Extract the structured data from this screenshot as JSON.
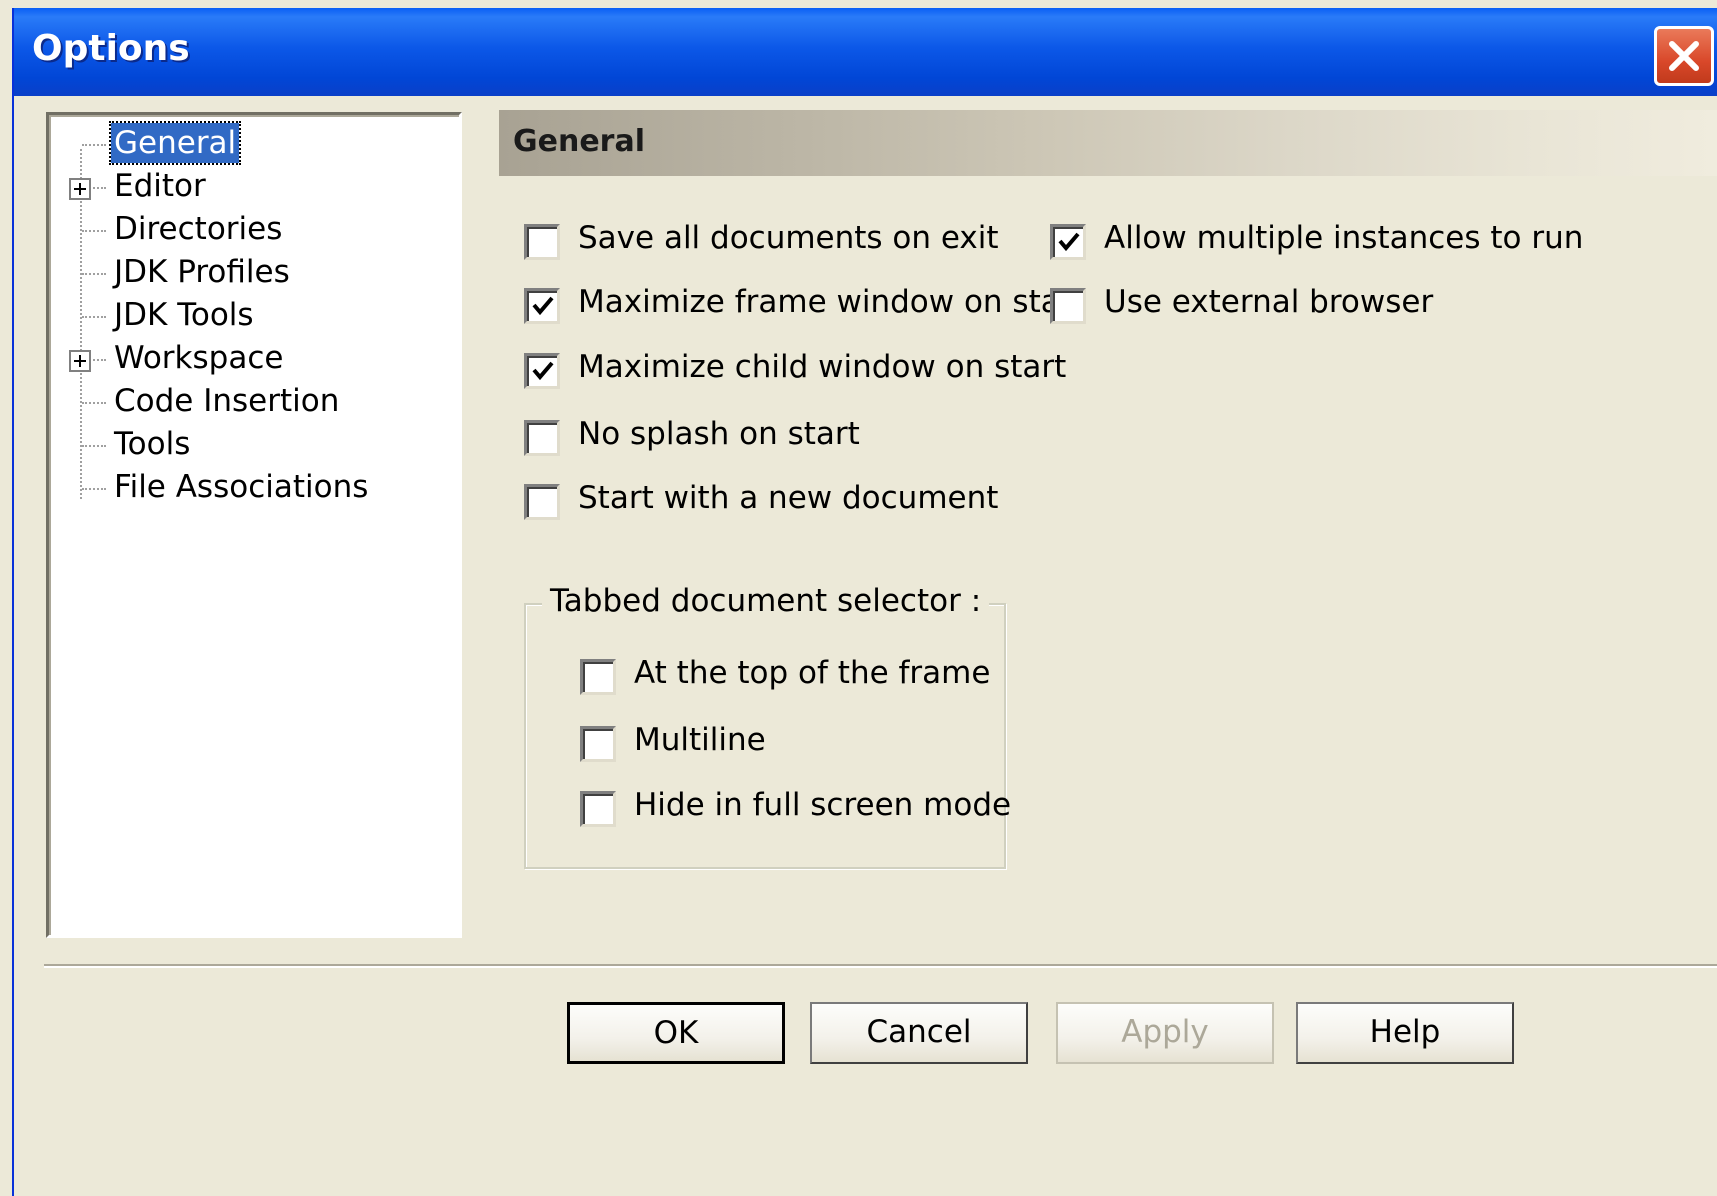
{
  "window": {
    "title": "Options"
  },
  "tree": {
    "items": [
      {
        "label": "General",
        "expandable": false,
        "selected": true
      },
      {
        "label": "Editor",
        "expandable": true,
        "selected": false
      },
      {
        "label": "Directories",
        "expandable": false,
        "selected": false
      },
      {
        "label": "JDK Profiles",
        "expandable": false,
        "selected": false
      },
      {
        "label": "JDK Tools",
        "expandable": false,
        "selected": false
      },
      {
        "label": "Workspace",
        "expandable": true,
        "selected": false
      },
      {
        "label": "Code Insertion",
        "expandable": false,
        "selected": false
      },
      {
        "label": "Tools",
        "expandable": false,
        "selected": false
      },
      {
        "label": "File Associations",
        "expandable": false,
        "selected": false
      }
    ]
  },
  "panel": {
    "title": "General"
  },
  "options": {
    "save_all": {
      "label": "Save all documents on exit",
      "checked": false
    },
    "max_frame": {
      "label": "Maximize frame window on start",
      "checked": true
    },
    "max_child": {
      "label": "Maximize child window on start",
      "checked": true
    },
    "no_splash": {
      "label": "No splash on start",
      "checked": false
    },
    "new_doc": {
      "label": "Start with a new document",
      "checked": false
    },
    "allow_multi": {
      "label": "Allow multiple instances to run",
      "checked": true
    },
    "ext_browser": {
      "label": "Use external browser",
      "checked": false
    }
  },
  "tab_group": {
    "legend": "Tabbed document selector :",
    "top_frame": {
      "label": "At the top of the frame",
      "checked": false
    },
    "multiline": {
      "label": "Multiline",
      "checked": false
    },
    "hide_full": {
      "label": "Hide in full screen mode",
      "checked": false
    }
  },
  "buttons": {
    "ok": "OK",
    "cancel": "Cancel",
    "apply": "Apply",
    "help": "Help"
  }
}
